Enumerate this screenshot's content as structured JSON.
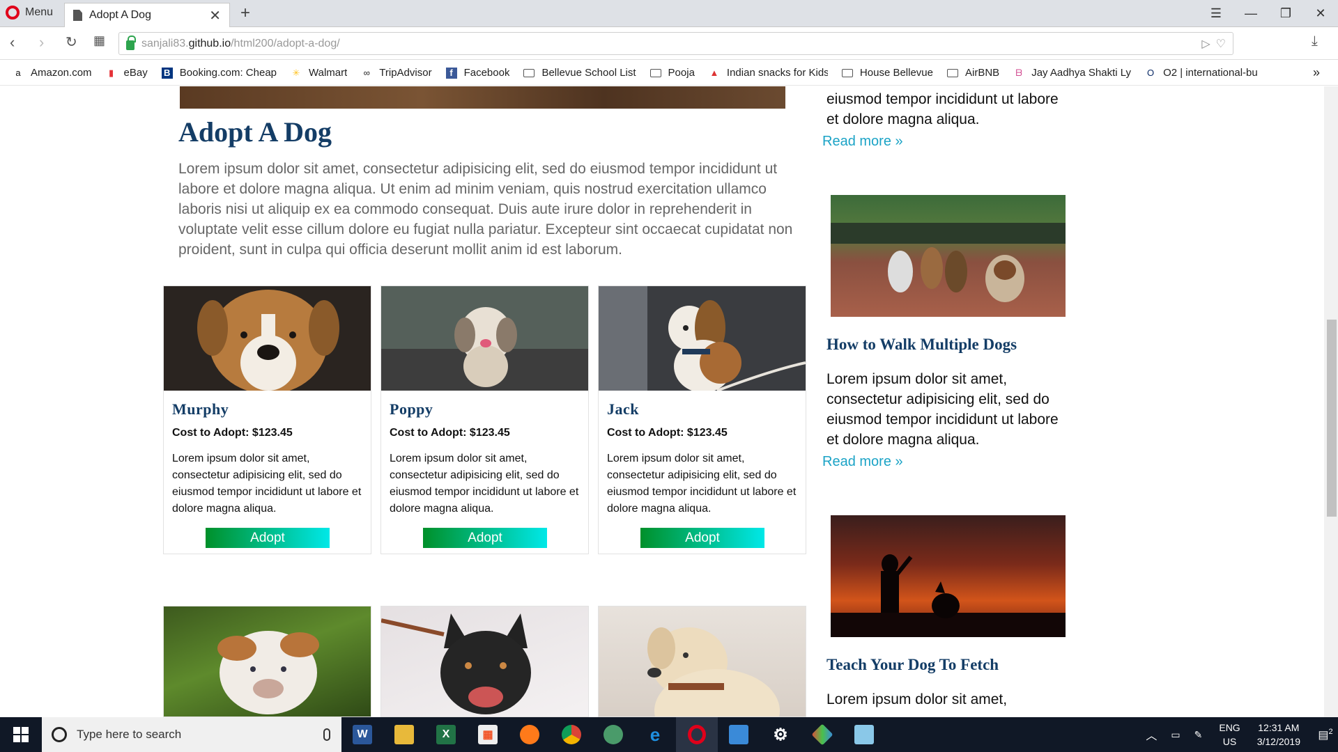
{
  "browser": {
    "menu_label": "Menu",
    "tab_title": "Adopt A Dog",
    "url_prefix": "sanjali83.",
    "url_host": "github.io",
    "url_path": "/html200/adopt-a-dog/",
    "bookmarks": [
      {
        "label": "Amazon.com",
        "icon": "amazon-icon"
      },
      {
        "label": "eBay",
        "icon": "ebay-icon"
      },
      {
        "label": "Booking.com: Cheap",
        "icon": "booking-icon"
      },
      {
        "label": "Walmart",
        "icon": "walmart-icon"
      },
      {
        "label": "TripAdvisor",
        "icon": "tripadvisor-icon"
      },
      {
        "label": "Facebook",
        "icon": "facebook-icon"
      },
      {
        "label": "Bellevue School List",
        "icon": "folder-icon"
      },
      {
        "label": "Pooja",
        "icon": "folder-icon"
      },
      {
        "label": "Indian snacks for Kids",
        "icon": "snacks-icon"
      },
      {
        "label": "House Bellevue",
        "icon": "folder-icon"
      },
      {
        "label": "AirBNB",
        "icon": "folder-icon"
      },
      {
        "label": "Jay Aadhya Shakti Ly",
        "icon": "music-icon"
      },
      {
        "label": "O2 | international-bu",
        "icon": "o2-icon"
      }
    ]
  },
  "main": {
    "title": "Adopt A Dog",
    "intro": "Lorem ipsum dolor sit amet, consectetur adipisicing elit, sed do eiusmod tempor incididunt ut labore et dolore magna aliqua. Ut enim ad minim veniam, quis nostrud exercitation ullamco laboris nisi ut aliquip ex ea commodo consequat. Duis aute irure dolor in reprehenderit in voluptate velit esse cillum dolore eu fugiat nulla pariatur. Excepteur sint occaecat cupidatat non proident, sunt in culpa qui officia deserunt mollit anim id est laborum.",
    "dogs": [
      {
        "name": "Murphy",
        "cost": "Cost to Adopt: $123.45",
        "desc": "Lorem ipsum dolor sit amet, consectetur adipisicing elit, sed do eiusmod tempor incididunt ut labore et dolore magna aliqua.",
        "button": "Adopt"
      },
      {
        "name": "Poppy",
        "cost": "Cost to Adopt: $123.45",
        "desc": "Lorem ipsum dolor sit amet, consectetur adipisicing elit, sed do eiusmod tempor incididunt ut labore et dolore magna aliqua.",
        "button": "Adopt"
      },
      {
        "name": "Jack",
        "cost": "Cost to Adopt: $123.45",
        "desc": "Lorem ipsum dolor sit amet, consectetur adipisicing elit, sed do eiusmod tempor incididunt ut labore et dolore magna aliqua.",
        "button": "Adopt"
      }
    ]
  },
  "sidebar": {
    "top_text": "eiusmod tempor incididunt ut labore et dolore magna aliqua.",
    "read_more": "Read more »",
    "articles": [
      {
        "title": "How to Walk Multiple Dogs",
        "text": "Lorem ipsum dolor sit amet, consectetur adipisicing elit, sed do eiusmod tempor incididunt ut labore et dolore magna aliqua.",
        "read_more": "Read more »"
      },
      {
        "title": "Teach Your Dog To Fetch",
        "text": "Lorem ipsum dolor sit amet,"
      }
    ]
  },
  "taskbar": {
    "search_placeholder": "Type here to search",
    "lang": "ENG",
    "region": "US",
    "time": "12:31 AM",
    "date": "3/12/2019",
    "notifications": "2"
  },
  "colors": {
    "title": "#143d66",
    "link": "#1ba3c6",
    "adopt_start": "#00902a",
    "adopt_end": "#00e8e8"
  }
}
